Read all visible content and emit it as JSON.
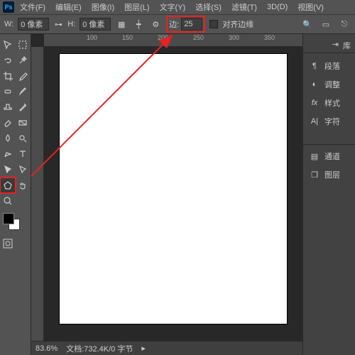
{
  "menubar": {
    "items": [
      "文件(F)",
      "编辑(E)",
      "图像(I)",
      "图层(L)",
      "文字(Y)",
      "选择(S)",
      "滤镜(T)",
      "3D(D)",
      "视图(V)"
    ]
  },
  "optbar": {
    "w_label": "W:",
    "w_value": "0 像素",
    "h_label": "H:",
    "h_value": "0 像素",
    "sides_label": "边:",
    "sides_value": "25",
    "align_label": "对齐边缘"
  },
  "ruler_ticks": [
    "100",
    "150",
    "200",
    "250",
    "300",
    "350"
  ],
  "status": {
    "zoom": "83.6%",
    "doc": "文档:732.4K/0 字节"
  },
  "panels": {
    "top_label": "库",
    "items": [
      {
        "icon": "paragraph",
        "label": "段落"
      },
      {
        "icon": "adjust",
        "label": "调整"
      },
      {
        "icon": "style",
        "label": "样式"
      },
      {
        "icon": "char",
        "label": "字符"
      }
    ],
    "items2": [
      {
        "icon": "channel",
        "label": "通道"
      },
      {
        "icon": "layer",
        "label": "图层"
      }
    ]
  },
  "icons": {
    "move": "move",
    "marquee": "marquee",
    "lasso": "lasso",
    "wand": "wand",
    "crop": "crop",
    "eyedrop": "eyedrop",
    "heal": "heal",
    "brush": "brush",
    "stamp": "stamp",
    "history": "history",
    "eraser": "eraser",
    "gradient": "gradient",
    "blur": "blur",
    "dodge": "dodge",
    "pen": "pen",
    "type": "type",
    "path": "path",
    "shape": "shape",
    "hand": "hand",
    "zoom": "zoom"
  }
}
